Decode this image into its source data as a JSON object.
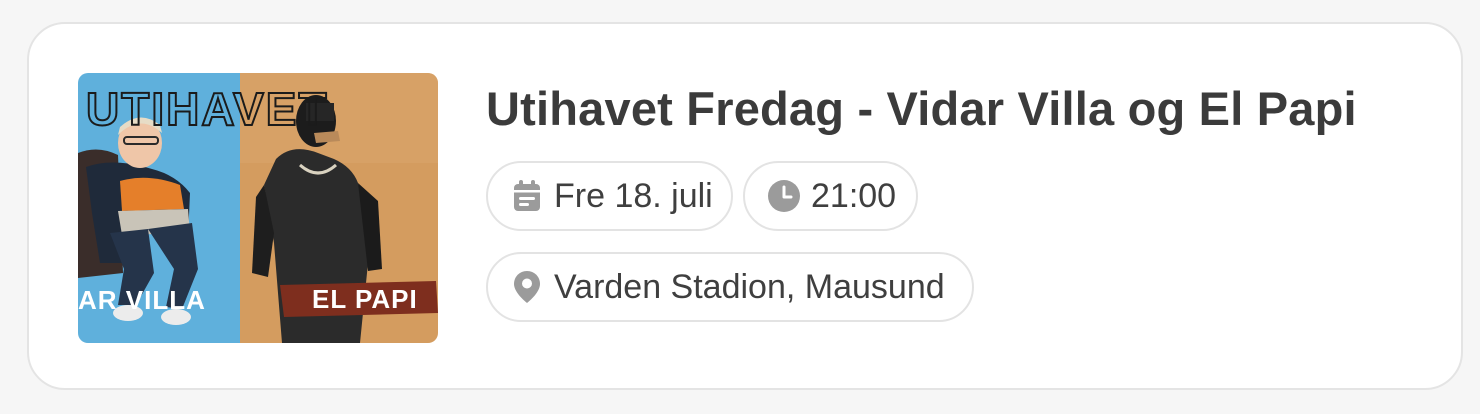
{
  "event": {
    "title": "Utihavet Fredag - Vidar Villa og El Papi",
    "date": "Fre 18. juli",
    "time": "21:00",
    "location": "Varden Stadion, Mausund"
  },
  "poster": {
    "headline": "UTIHAVET",
    "left_artist": "AR VILLA",
    "right_artist": "EL PAPI"
  },
  "icons": {
    "date": "calendar-icon",
    "time": "clock-icon",
    "location": "map-pin-icon"
  },
  "colors": {
    "icon": "#9b9b9b",
    "text": "#3b3b3b",
    "border": "#e3e3e3",
    "poster_left": "#5eaedb",
    "poster_right": "#d39b5f"
  }
}
